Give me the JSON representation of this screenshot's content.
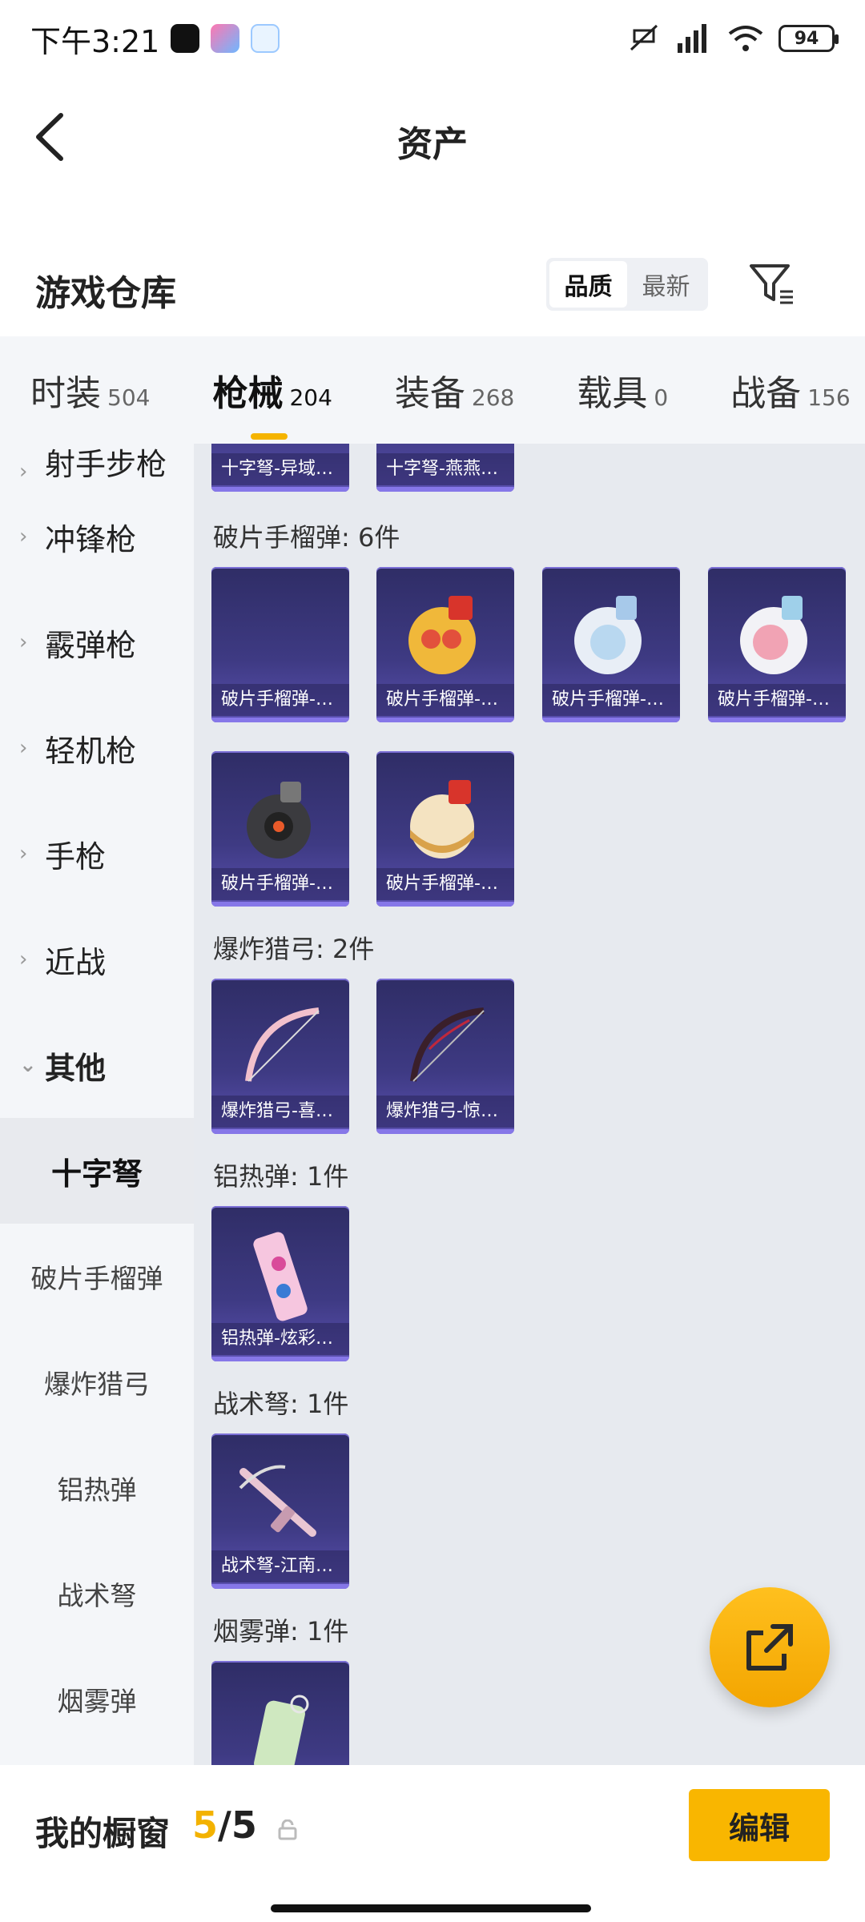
{
  "status_bar": {
    "time": "下午3:21",
    "battery": "94"
  },
  "header": {
    "title": "资产"
  },
  "warehouse": {
    "title": "游戏仓库",
    "sort_options": [
      "品质",
      "最新"
    ],
    "active_sort": "品质"
  },
  "tabs": [
    {
      "name": "时装",
      "count": "504"
    },
    {
      "name": "枪械",
      "count": "204",
      "active": true
    },
    {
      "name": "装备",
      "count": "268"
    },
    {
      "name": "载具",
      "count": "0"
    },
    {
      "name": "战备",
      "count": "156"
    }
  ],
  "sidebar": {
    "main_categories": [
      "射手步枪",
      "冲锋枪",
      "霰弹枪",
      "轻机枪",
      "手枪",
      "近战",
      "其他"
    ],
    "sub_categories": [
      "十字弩",
      "破片手榴弹",
      "爆炸猎弓",
      "铝热弹",
      "战术弩",
      "烟雾弹"
    ],
    "active_sub": "十字弩"
  },
  "content": {
    "top_cards": [
      "十字弩-异域…",
      "十字弩-燕燕…"
    ],
    "sections": [
      {
        "label": "破片手榴弹: 6件",
        "items": [
          "破片手榴弹-…",
          "破片手榴弹-…",
          "破片手榴弹-…",
          "破片手榴弹-…",
          "破片手榴弹-…",
          "破片手榴弹-…"
        ]
      },
      {
        "label": "爆炸猎弓: 2件",
        "items": [
          "爆炸猎弓-喜…",
          "爆炸猎弓-惊…"
        ]
      },
      {
        "label": "铝热弹: 1件",
        "items": [
          "铝热弹-炫彩…"
        ]
      },
      {
        "label": "战术弩: 1件",
        "items": [
          "战术弩-江南…"
        ]
      },
      {
        "label": "烟雾弹: 1件",
        "items": [
          ""
        ]
      }
    ]
  },
  "bottom": {
    "my_window": "我的橱窗",
    "current": "5",
    "total": "/5",
    "edit": "编辑"
  },
  "colors": {
    "accent": "#f9b600",
    "card_bg": "#3e3a83"
  }
}
